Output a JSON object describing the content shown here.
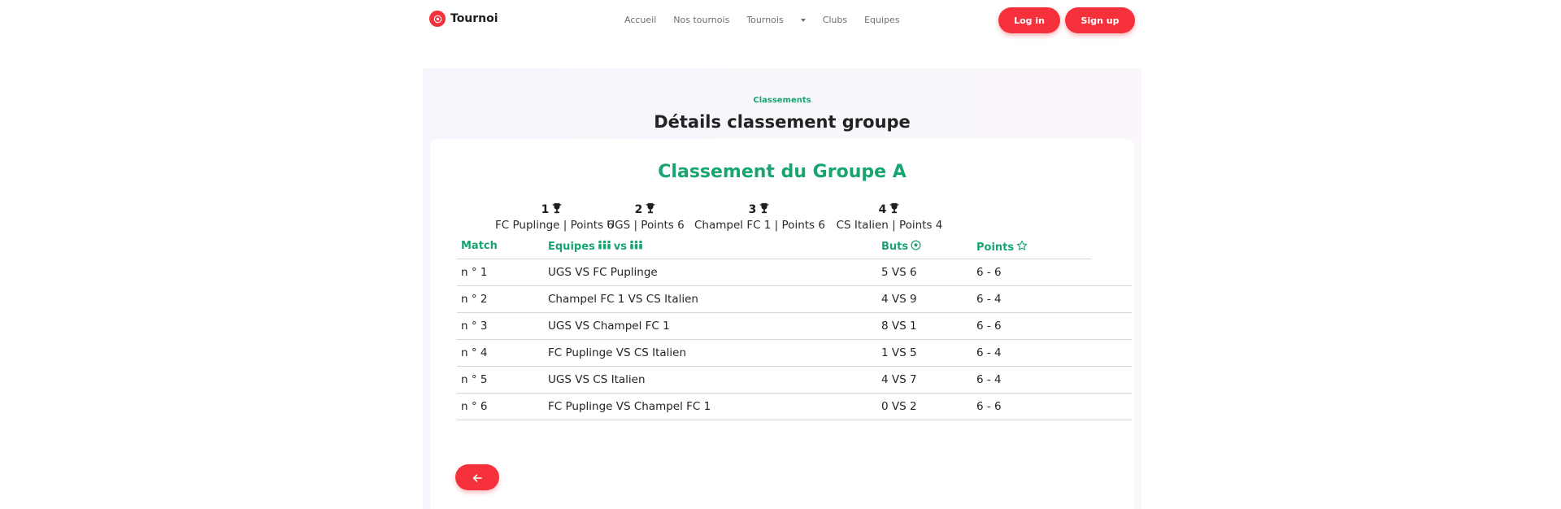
{
  "header": {
    "brand": "Tournoi",
    "nav": [
      "Accueil",
      "Nos tournois",
      "Tournois",
      "Clubs",
      "Equipes"
    ],
    "login": "Log in",
    "signup": "Sign up"
  },
  "section": {
    "subtitle": "Classements",
    "title": "Détails classement groupe"
  },
  "card": {
    "title": "Classement du Groupe A",
    "podium": [
      {
        "rank": "1",
        "team": "FC Puplinge | Points 6"
      },
      {
        "rank": "2",
        "team": "UGS | Points 6"
      },
      {
        "rank": "3",
        "team": "Champel FC 1 | Points 6"
      },
      {
        "rank": "4",
        "team": "CS Italien | Points 4"
      }
    ],
    "table": {
      "headers": {
        "match": "Match",
        "equipes": "Equipes",
        "vs": "vs",
        "buts": "Buts",
        "points": "Points"
      },
      "rows": [
        {
          "match": "n ° 1",
          "equipes": "UGS VS FC Puplinge",
          "buts": "5 VS 6",
          "points": "6 - 6"
        },
        {
          "match": "n ° 2",
          "equipes": "Champel FC 1 VS CS Italien",
          "buts": "4 VS 9",
          "points": "6 - 4"
        },
        {
          "match": "n ° 3",
          "equipes": "UGS VS Champel FC 1",
          "buts": "8 VS 1",
          "points": "6 - 6"
        },
        {
          "match": "n ° 4",
          "equipes": "FC Puplinge VS CS Italien",
          "buts": "1 VS 5",
          "points": "6 - 4"
        },
        {
          "match": "n ° 5",
          "equipes": "UGS VS CS Italien",
          "buts": "4 VS 7",
          "points": "6 - 4"
        },
        {
          "match": "n ° 6",
          "equipes": "FC Puplinge VS Champel FC 1",
          "buts": "0 VS 2",
          "points": "6 - 6"
        }
      ]
    }
  },
  "icons": {
    "logo": "soccer-ball-icon",
    "trophy": "trophy-icon",
    "team": "people-icon",
    "goal": "soccer-ball-icon",
    "points": "star-icon",
    "back": "arrow-left-icon"
  },
  "colors": {
    "accent": "#f6313b",
    "green": "#18a56f"
  }
}
